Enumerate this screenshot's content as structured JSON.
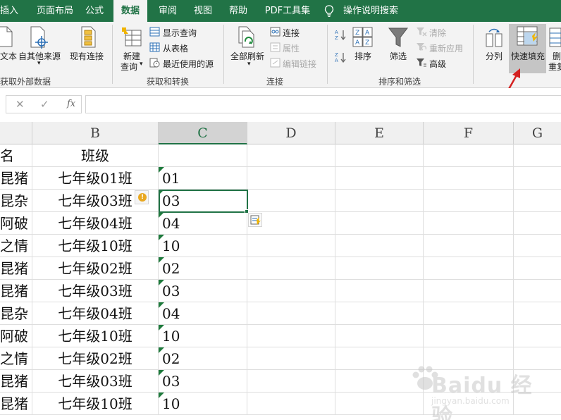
{
  "tabs": [
    "插入",
    "页面布局",
    "公式",
    "数据",
    "审阅",
    "视图",
    "帮助",
    "PDF工具集",
    "操作说明搜索"
  ],
  "active_tab": "数据",
  "ribbon": {
    "get_data": {
      "from_text": "文本",
      "from_other": "自其他来源",
      "existing": "现有连接",
      "group_label": "获取外部数据"
    },
    "get_transform": {
      "new_query": "新建",
      "new_query_2": "查询",
      "show_queries": "显示查询",
      "from_table": "从表格",
      "recent_sources": "最近使用的源",
      "group_label": "获取和转换"
    },
    "connections": {
      "refresh_all": "全部刷新",
      "connections": "连接",
      "properties": "属性",
      "edit_links": "编辑链接",
      "group_label": "连接"
    },
    "sort_filter": {
      "sort": "排序",
      "filter": "筛选",
      "clear": "清除",
      "reapply": "重新应用",
      "advanced": "高级",
      "group_label": "排序和筛选"
    },
    "data_tools": {
      "split_col": "分列",
      "flash_fill": "快速填充",
      "remove_dup_1": "删",
      "remove_dup_2": "重复"
    }
  },
  "formula_bar": {
    "cancel": "✕",
    "enter": "✓",
    "fx": "fx",
    "value": ""
  },
  "columns": [
    "B",
    "C",
    "D",
    "E",
    "F",
    "G"
  ],
  "rows": [
    {
      "a": "名",
      "b": "班级",
      "c": ""
    },
    {
      "a": "昆猪",
      "b": "七年级01班",
      "c": "01"
    },
    {
      "a": "昆杂",
      "b": "七年级03班",
      "c": "03"
    },
    {
      "a": "阿破",
      "b": "七年级04班",
      "c": "04"
    },
    {
      "a": "之情",
      "b": "七年级10班",
      "c": "10"
    },
    {
      "a": "昆猪",
      "b": "七年级02班",
      "c": "02"
    },
    {
      "a": "昆猪",
      "b": "七年级03班",
      "c": "03"
    },
    {
      "a": "昆杂",
      "b": "七年级04班",
      "c": "04"
    },
    {
      "a": "阿破",
      "b": "七年级10班",
      "c": "10"
    },
    {
      "a": "之情",
      "b": "七年级02班",
      "c": "02"
    },
    {
      "a": "昆猪",
      "b": "七年级03班",
      "c": "03"
    },
    {
      "a": "昆猪",
      "b": "七年级10班",
      "c": "10"
    }
  ],
  "watermark": {
    "main": "Baidu 经验",
    "sub": "jingyan.baidu.com"
  },
  "colors": {
    "excel_green": "#217346",
    "arrow_red": "#d42020",
    "triangle": "#1e7a3c"
  }
}
